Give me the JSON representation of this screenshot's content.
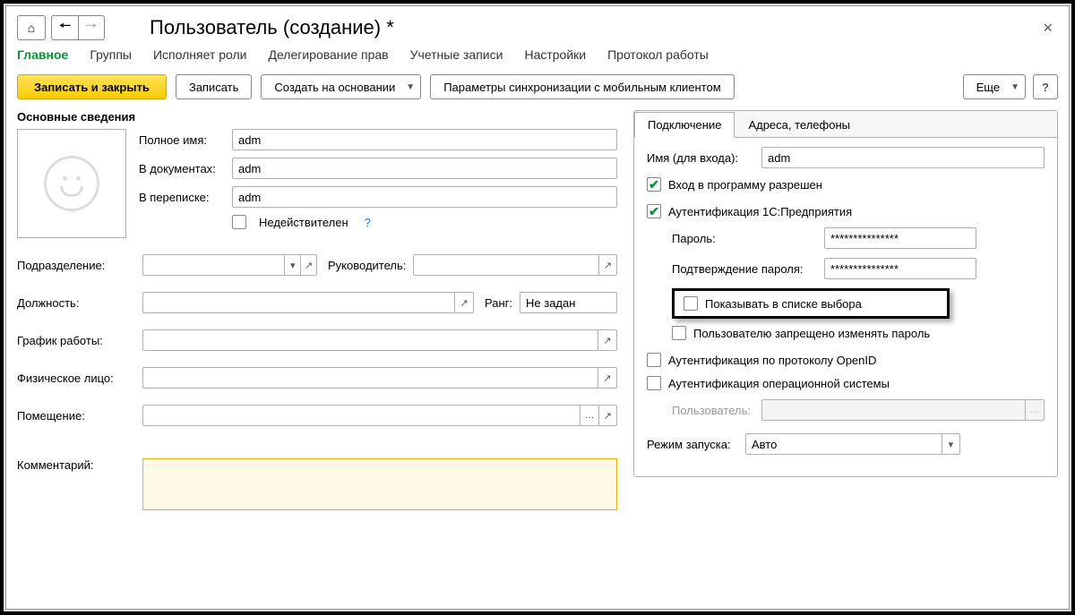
{
  "title": "Пользователь (создание) *",
  "tabs": [
    "Главное",
    "Группы",
    "Исполняет роли",
    "Делегирование прав",
    "Учетные записи",
    "Настройки",
    "Протокол работы"
  ],
  "toolbar": {
    "save_close": "Записать и закрыть",
    "save": "Записать",
    "create_on": "Создать на основании",
    "sync_params": "Параметры синхронизации с мобильным клиентом",
    "more": "Еще",
    "help": "?"
  },
  "section_basic": "Основные сведения",
  "left": {
    "full_name_lbl": "Полное имя:",
    "full_name": "adm",
    "in_docs_lbl": "В документах:",
    "in_docs": "adm",
    "in_corr_lbl": "В переписке:",
    "in_corr": "adm",
    "invalid_lbl": "Недействителен",
    "qmark": "?",
    "department_lbl": "Подразделение:",
    "manager_lbl": "Руководитель:",
    "position_lbl": "Должность:",
    "rank_lbl": "Ранг:",
    "rank_val": "Не задан",
    "schedule_lbl": "График работы:",
    "person_lbl": "Физическое лицо:",
    "room_lbl": "Помещение:",
    "comment_lbl": "Комментарий:"
  },
  "right_tabs": [
    "Подключение",
    "Адреса, телефоны"
  ],
  "right": {
    "login_lbl": "Имя (для входа):",
    "login": "adm",
    "login_allowed": "Вход в программу разрешен",
    "auth_1c": "Аутентификация 1С:Предприятия",
    "password_lbl": "Пароль:",
    "password_val": "***************",
    "password2_lbl": "Подтверждение пароля:",
    "password2_val": "***************",
    "show_in_list": "Показывать в списке выбора",
    "no_change_pw": "Пользователю запрещено изменять пароль",
    "auth_openid": "Аутентификация по протоколу OpenID",
    "auth_os": "Аутентификация операционной системы",
    "os_user_lbl": "Пользователь:",
    "run_mode_lbl": "Режим запуска:",
    "run_mode": "Авто"
  }
}
